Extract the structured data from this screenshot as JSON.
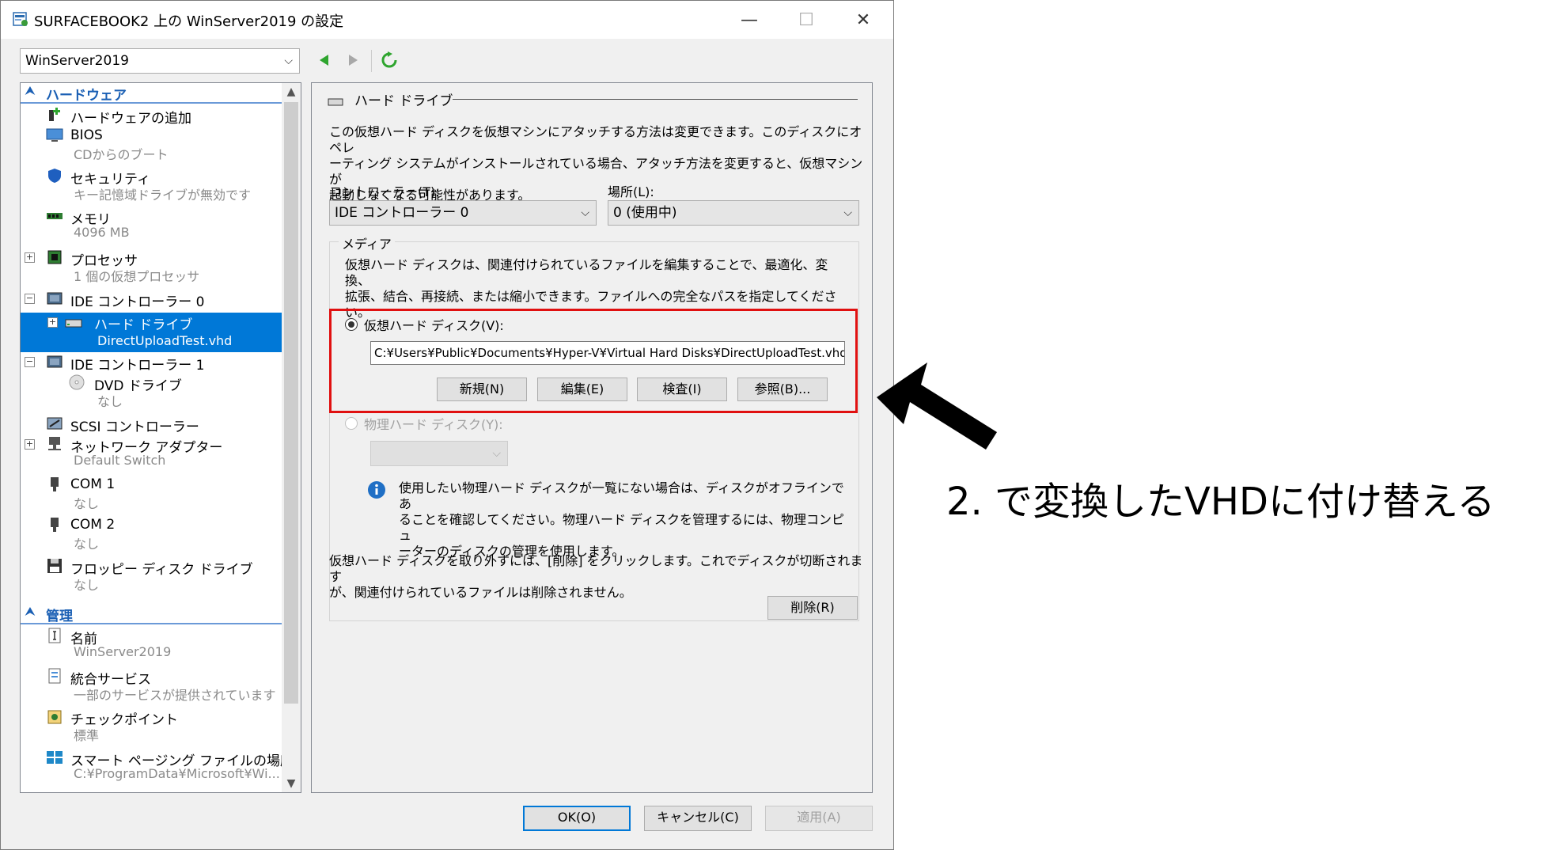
{
  "window": {
    "title": "SURFACEBOOK2 上の WinServer2019 の設定",
    "minimize": "—",
    "maximize": "☐",
    "close": "✕"
  },
  "vm_selector": {
    "value": "WinServer2019"
  },
  "sidebar": {
    "hardware_section": "ハードウェア",
    "management_section": "管理",
    "items": [
      {
        "label": "ハードウェアの追加",
        "sub": ""
      },
      {
        "label": "BIOS",
        "sub": "CDからのブート"
      },
      {
        "label": "セキュリティ",
        "sub": "キー記憶域ドライブが無効です"
      },
      {
        "label": "メモリ",
        "sub": "4096 MB"
      },
      {
        "label": "プロセッサ",
        "sub": "1 個の仮想プロセッサ"
      },
      {
        "label": "IDE コントローラー 0",
        "sub": ""
      },
      {
        "label": "ハード ドライブ",
        "sub": "DirectUploadTest.vhd"
      },
      {
        "label": "IDE コントローラー 1",
        "sub": ""
      },
      {
        "label": "DVD ドライブ",
        "sub": "なし"
      },
      {
        "label": "SCSI コントローラー",
        "sub": ""
      },
      {
        "label": "ネットワーク アダプター",
        "sub": "Default Switch"
      },
      {
        "label": "COM 1",
        "sub": "なし"
      },
      {
        "label": "COM 2",
        "sub": "なし"
      },
      {
        "label": "フロッピー ディスク ドライブ",
        "sub": "なし"
      }
    ],
    "mgmt_items": [
      {
        "label": "名前",
        "sub": "WinServer2019"
      },
      {
        "label": "統合サービス",
        "sub": "一部のサービスが提供されています"
      },
      {
        "label": "チェックポイント",
        "sub": "標準"
      },
      {
        "label": "スマート ページング ファイルの場所",
        "sub": "C:¥ProgramData¥Microsoft¥Wi..."
      }
    ]
  },
  "detail": {
    "group_title": "ハード ドライブ",
    "intro_lines": [
      "この仮想ハード ディスクを仮想マシンにアタッチする方法は変更できます。このディスクにオペレ",
      "ーティング システムがインストールされている場合、アタッチ方法を変更すると、仮想マシンが",
      "起動しなくなる可能性があります。"
    ],
    "controller_label": "コントローラー(T):",
    "controller_value": "IDE コントローラー 0",
    "location_label": "場所(L):",
    "location_value": "0 (使用中)",
    "media_label": "メディア",
    "media_lines": [
      "仮想ハード ディスクは、関連付けられているファイルを編集することで、最適化、変換、",
      "拡張、結合、再接続、または縮小できます。ファイルへの完全なパスを指定してくださ",
      "い。"
    ],
    "vhd_radio_label": "仮想ハード ディスク(V):",
    "vhd_path": "C:¥Users¥Public¥Documents¥Hyper-V¥Virtual Hard Disks¥DirectUploadTest.vhd",
    "new_button": "新規(N)",
    "edit_button": "編集(E)",
    "inspect_button": "検査(I)",
    "browse_button": "参照(B)...",
    "physical_radio_label": "物理ハード ディスク(Y):",
    "info_lines": [
      "使用したい物理ハード ディスクが一覧にない場合は、ディスクがオフラインであ",
      "ることを確認してください。物理ハード ディスクを管理するには、物理コンピュ",
      "ーターのディスクの管理を使用します。"
    ],
    "remove_lines": [
      "仮想ハード ディスクを取り外すには、[削除] をクリックします。これでディスクが切断されます",
      "が、関連付けられているファイルは削除されません。"
    ],
    "remove_button": "削除(R)"
  },
  "footer": {
    "ok_button": "OK(O)",
    "cancel_button": "キャンセル(C)",
    "apply_button": "適用(A)"
  },
  "annotation": {
    "text": "2. で変換したVHDに付け替える"
  },
  "colors": {
    "accent": "#0078d7",
    "highlight_box": "#e01010",
    "section_text": "#1a5fb4"
  }
}
